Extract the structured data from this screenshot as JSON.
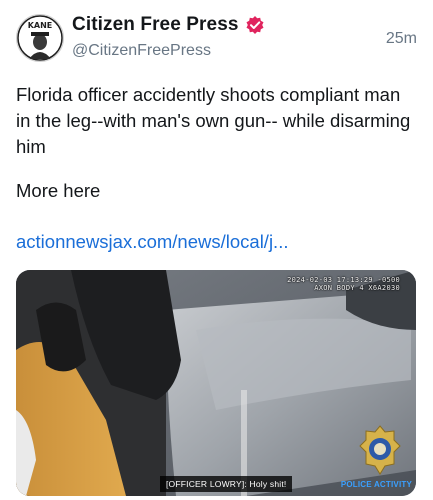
{
  "author": {
    "display_name": "Citizen Free Press",
    "handle": "@CitizenFreePress",
    "avatar_text": "KANE",
    "verified": true,
    "verified_color": "#e0245e"
  },
  "post": {
    "timestamp": "25m",
    "text": "Florida officer accidently shoots compliant man in the leg--with man's own gun-- while disarming him",
    "more": "More here",
    "link": "actionnewsjax.com/news/local/j..."
  },
  "media": {
    "overlay_line1": "2024-02-03 17:13:29 -0500",
    "overlay_line2": "AXON BODY 4 X6A2030",
    "caption": "[OFFICER LOWRY]: Holy shit!",
    "watermark": "POLICE ACTIVITY"
  },
  "colors": {
    "link": "#1a6ed8",
    "secondary_text": "#687684"
  }
}
